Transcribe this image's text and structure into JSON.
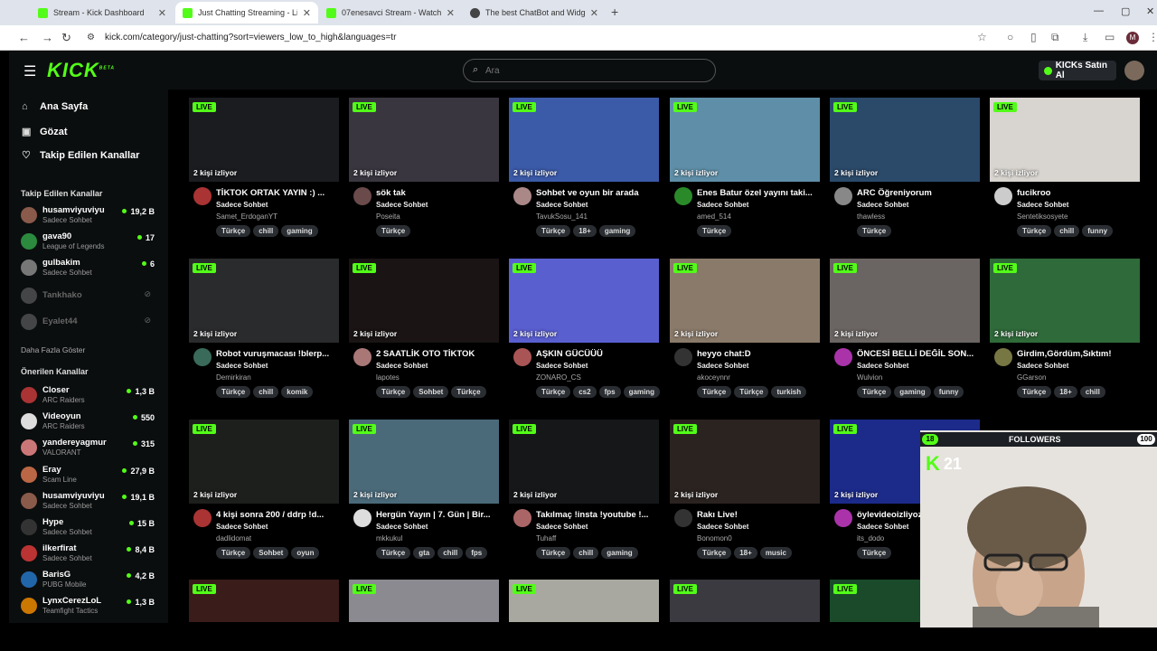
{
  "browser": {
    "tabs": [
      {
        "title": "Stream - Kick Dashboard",
        "fav": "k"
      },
      {
        "title": "Just Chatting Streaming - Live S",
        "fav": "k"
      },
      {
        "title": "07enesavci Stream - Watch Live",
        "fav": "k"
      },
      {
        "title": "The best ChatBot and Widgets",
        "fav": "g"
      }
    ],
    "url": "kick.com/category/just-chatting?sort=viewers_low_to_high&languages=tr",
    "profile_initial": "M"
  },
  "header": {
    "logo": "KICK",
    "logo_sup": "BETA",
    "search_placeholder": "Ara",
    "buy_label": "KICKs Satın Al"
  },
  "sidebar": {
    "nav": [
      {
        "label": "Ana Sayfa",
        "icon": "home-icon"
      },
      {
        "label": "Gözat",
        "icon": "browse-icon"
      },
      {
        "label": "Takip Edilen Kanallar",
        "icon": "heart-icon"
      }
    ],
    "followed_title": "Takip Edilen Kanallar",
    "followed": [
      {
        "name": "husamviyuviyu",
        "sub": "Sadece Sohbet",
        "viewers": "19,2 B",
        "color": "#8a5a4a"
      },
      {
        "name": "gava90",
        "sub": "League of Legends",
        "viewers": "17",
        "color": "#2b8a3e"
      },
      {
        "name": "gulbakim",
        "sub": "Sadece Sohbet",
        "viewers": "6",
        "color": "#777"
      },
      {
        "name": "Tankhako",
        "sub": "",
        "viewers": "",
        "color": "#999",
        "offline": true
      },
      {
        "name": "Eyalet44",
        "sub": "",
        "viewers": "",
        "color": "#999",
        "offline": true
      }
    ],
    "more_label": "Daha Fazla Göster",
    "recommended_title": "Önerilen Kanallar",
    "recommended": [
      {
        "name": "Closer",
        "sub": "ARC Raiders",
        "viewers": "1,3 B",
        "color": "#a33"
      },
      {
        "name": "Videoyun",
        "sub": "ARC Raiders",
        "viewers": "550",
        "color": "#ddd"
      },
      {
        "name": "yandereyagmur",
        "sub": "VALORANT",
        "viewers": "315",
        "color": "#c77"
      },
      {
        "name": "Eray",
        "sub": "Scam Line",
        "viewers": "27,9 B",
        "color": "#b64"
      },
      {
        "name": "husamviyuviyu",
        "sub": "Sadece Sohbet",
        "viewers": "19,1 B",
        "color": "#8a5a4a"
      },
      {
        "name": "Hype",
        "sub": "Sadece Sohbet",
        "viewers": "15 B",
        "color": "#333"
      },
      {
        "name": "ilkerfirat",
        "sub": "Sadece Sohbet",
        "viewers": "8,4 B",
        "color": "#b33"
      },
      {
        "name": "BarisG",
        "sub": "PUBG Mobile",
        "viewers": "4,2 B",
        "color": "#26a"
      },
      {
        "name": "LynxCerezLoL",
        "sub": "Teamfight Tactics",
        "viewers": "1,3 B",
        "color": "#c70"
      }
    ]
  },
  "live_label": "LIVE",
  "streams": [
    {
      "title": "TİKTOK ORTAK YAYIN :) ...",
      "category": "Sadece Sohbet",
      "user": "Samet_ErdoganYT",
      "viewers": "2 kişi izliyor",
      "tags": [
        "Türkçe",
        "chill",
        "gaming"
      ],
      "bg": "#1a1c1f",
      "av": "#a33"
    },
    {
      "title": "sök tak",
      "category": "Sadece Sohbet",
      "user": "Poseita",
      "viewers": "2 kişi izliyor",
      "tags": [
        "Türkçe"
      ],
      "bg": "#3a3640",
      "av": "#6a4a4a"
    },
    {
      "title": "Sohbet ve oyun bir arada",
      "category": "Sadece Sohbet",
      "user": "TavukSosu_141",
      "viewers": "2 kişi izliyor",
      "tags": [
        "Türkçe",
        "18+",
        "gaming"
      ],
      "bg": "#3b5aa8",
      "av": "#a88"
    },
    {
      "title": "Enes Batur özel yayını taki...",
      "category": "Sadece Sohbet",
      "user": "amed_514",
      "viewers": "2 kişi izliyor",
      "tags": [
        "Türkçe"
      ],
      "bg": "#5f8fa8",
      "av": "#2a8a2a"
    },
    {
      "title": "ARC Öğreniyorum",
      "category": "Sadece Sohbet",
      "user": "thawless",
      "viewers": "2 kişi izliyor",
      "tags": [
        "Türkçe"
      ],
      "bg": "#2b4a6a",
      "av": "#888"
    },
    {
      "title": "fucikroo",
      "category": "Sadece Sohbet",
      "user": "Sentetiksosyete",
      "viewers": "2 kişi izliyor",
      "tags": [
        "Türkçe",
        "chill",
        "funny"
      ],
      "bg": "#d8d4cf",
      "av": "#ccc"
    },
    {
      "title": "Robot vuruşmacası !blerp...",
      "category": "Sadece Sohbet",
      "user": "Demirkiran",
      "viewers": "2 kişi izliyor",
      "tags": [
        "Türkçe",
        "chill",
        "komik"
      ],
      "bg": "#2a2b2c",
      "av": "#3a6a5a"
    },
    {
      "title": "2 SAATLİK OTO TİKTOK",
      "category": "Sadece Sohbet",
      "user": "lapotes",
      "viewers": "2 kişi izliyor",
      "tags": [
        "Türkçe",
        "Sohbet",
        "Türkçe"
      ],
      "bg": "#1a1414",
      "av": "#a77"
    },
    {
      "title": "AŞKIN GÜCÜÜÜ",
      "category": "Sadece Sohbet",
      "user": "ZONARO_CS",
      "viewers": "2 kişi izliyor",
      "tags": [
        "Türkçe",
        "cs2",
        "fps",
        "gaming"
      ],
      "bg": "#5a5fd0",
      "av": "#a55"
    },
    {
      "title": "heyyo chat:D",
      "category": "Sadece Sohbet",
      "user": "akoceynnr",
      "viewers": "2 kişi izliyor",
      "tags": [
        "Türkçe",
        "Türkçe",
        "turkish"
      ],
      "bg": "#8a7a6a",
      "av": "#333"
    },
    {
      "title": "ÖNCESİ BELLİ DEĞİL SON...",
      "category": "Sadece Sohbet",
      "user": "Wulvion",
      "viewers": "2 kişi izliyor",
      "tags": [
        "Türkçe",
        "gaming",
        "funny"
      ],
      "bg": "#6a6462",
      "av": "#a3a"
    },
    {
      "title": "Girdim,Gördüm,Sıktım!",
      "category": "Sadece Sohbet",
      "user": "GGarson",
      "viewers": "2 kişi izliyor",
      "tags": [
        "Türkçe",
        "18+",
        "chill"
      ],
      "bg": "#2f6a3a",
      "av": "#774"
    },
    {
      "title": "4 kişi sonra 200 / ddrp !d...",
      "category": "Sadece Sohbet",
      "user": "dadlidomat",
      "viewers": "2 kişi izliyor",
      "tags": [
        "Türkçe",
        "Sohbet",
        "oyun"
      ],
      "bg": "#1d1f1c",
      "av": "#a33"
    },
    {
      "title": "Hergün Yayın | 7. Gün | Bir...",
      "category": "Sadece Sohbet",
      "user": "mkkukul",
      "viewers": "2 kişi izliyor",
      "tags": [
        "Türkçe",
        "gta",
        "chill",
        "fps"
      ],
      "bg": "#4a6a7a",
      "av": "#ddd"
    },
    {
      "title": "Takılmaç !insta !youtube !...",
      "category": "Sadece Sohbet",
      "user": "Tuhaff",
      "viewers": "2 kişi izliyor",
      "tags": [
        "Türkçe",
        "chill",
        "gaming"
      ],
      "bg": "#151719",
      "av": "#a66"
    },
    {
      "title": "Rakı Live!",
      "category": "Sadece Sohbet",
      "user": "Bonomon0",
      "viewers": "2 kişi izliyor",
      "tags": [
        "Türkçe",
        "18+",
        "music"
      ],
      "bg": "#2a2320",
      "av": "#333"
    },
    {
      "title": "öylevideoizliyoz",
      "category": "Sadece Sohbet",
      "user": "its_dodo",
      "viewers": "2 kişi izliyor",
      "tags": [
        "Türkçe"
      ],
      "bg": "#1c2a8a",
      "av": "#a3a"
    },
    {
      "title": "",
      "category": "",
      "user": "",
      "viewers": "",
      "tags": [],
      "bg": "#2060b0",
      "av": "#000"
    },
    {
      "title": "",
      "category": "",
      "user": "",
      "viewers": "",
      "tags": [],
      "bg": "#3a1c1a",
      "av": "#000"
    },
    {
      "title": "",
      "category": "",
      "user": "",
      "viewers": "",
      "tags": [],
      "bg": "#8a8a90",
      "av": "#000"
    },
    {
      "title": "",
      "category": "",
      "user": "",
      "viewers": "",
      "tags": [],
      "bg": "#a8a8a0",
      "av": "#000"
    },
    {
      "title": "",
      "category": "",
      "user": "",
      "viewers": "",
      "tags": [],
      "bg": "#3a3a40",
      "av": "#000"
    },
    {
      "title": "",
      "category": "",
      "user": "",
      "viewers": "",
      "tags": [],
      "bg": "#1a4a2a",
      "av": "#000"
    }
  ],
  "overlay": {
    "followers_left": "18",
    "followers_label": "FOLLOWERS",
    "followers_right": "100",
    "k_count": "21",
    "banner": "YAYIN BAŞLIYOR"
  }
}
